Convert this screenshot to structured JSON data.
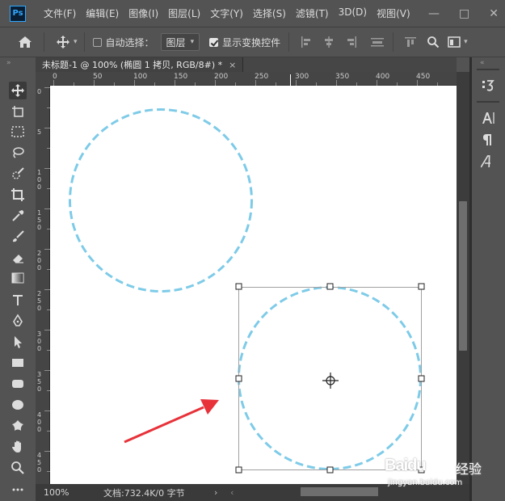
{
  "app": {
    "logo": "Ps"
  },
  "menu": {
    "items": [
      "文件(F)",
      "编辑(E)",
      "图像(I)",
      "图层(L)",
      "文字(Y)",
      "选择(S)",
      "滤镜(T)",
      "3D(D)",
      "视图(V)"
    ]
  },
  "window_controls": {
    "minimize": "—",
    "maximize": "□",
    "close": "✕"
  },
  "options_bar": {
    "auto_select_label": "自动选择：",
    "auto_select_checked": false,
    "target_select": "图层",
    "show_transform_label": "显示变换控件",
    "show_transform_checked": true
  },
  "document": {
    "tab_title": "未标题-1 @ 100% (椭圆 1 拷贝, RGB/8#) *",
    "close": "×"
  },
  "ruler": {
    "top_labels": [
      "0",
      "50",
      "100",
      "150",
      "200",
      "250",
      "300",
      "350",
      "400",
      "450"
    ],
    "left_labels": [
      "0",
      "5",
      "1\n0\n0",
      "1\n5\n0",
      "2\n0\n0",
      "2\n5\n0",
      "3\n0\n0",
      "3\n5\n0",
      "4\n0\n0",
      "4\n5\n0"
    ]
  },
  "status": {
    "zoom": "100%",
    "doc_info": "文档:732.4K/0 字节",
    "arrow_right": "›",
    "arrow_left": "‹"
  },
  "right_panel": {
    "icons": [
      "history-icon",
      "character-icon",
      "paragraph-icon",
      "glyphs-icon"
    ]
  },
  "colors": {
    "circle_stroke": "#7ecbe8",
    "annotation_arrow": "#e8323a",
    "canvas_bg": "#ffffff",
    "ui_bg": "#535353"
  },
  "watermark": {
    "brand": "Baidu",
    "text": "经验",
    "domain": "jingyan.baidu.com"
  }
}
